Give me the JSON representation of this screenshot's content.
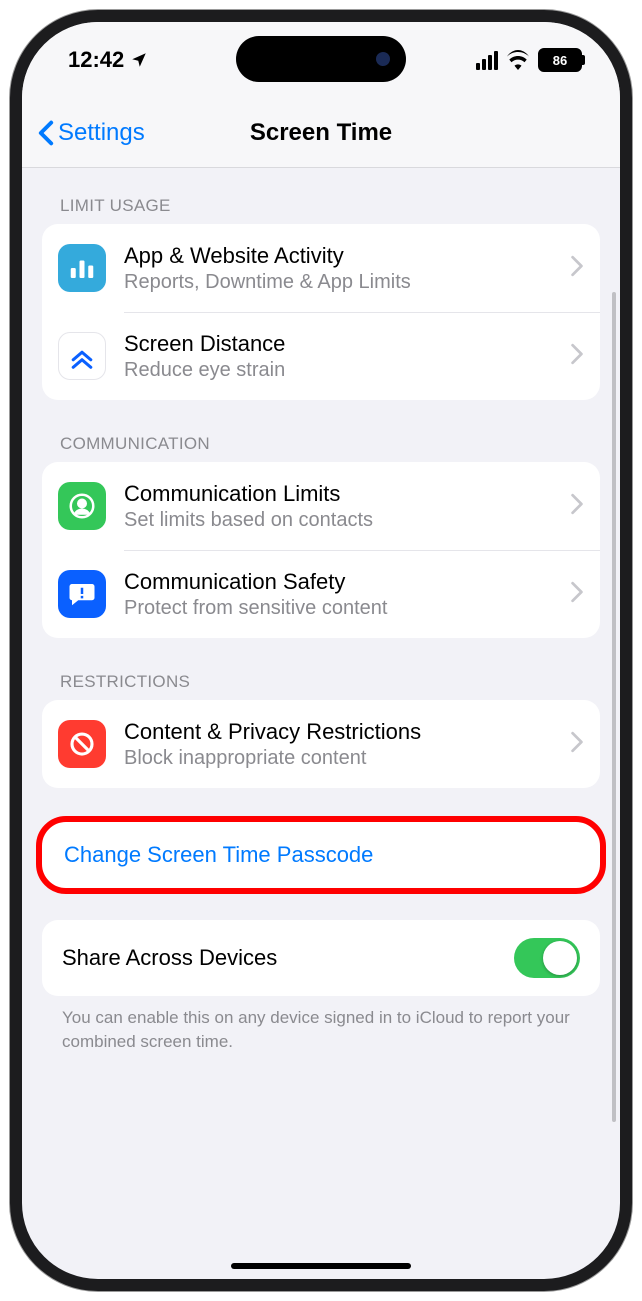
{
  "status": {
    "time": "12:42",
    "battery": "86"
  },
  "nav": {
    "back_label": "Settings",
    "title": "Screen Time"
  },
  "sections": {
    "limit_usage": {
      "header": "LIMIT USAGE",
      "items": [
        {
          "title": "App & Website Activity",
          "subtitle": "Reports, Downtime & App Limits"
        },
        {
          "title": "Screen Distance",
          "subtitle": "Reduce eye strain"
        }
      ]
    },
    "communication": {
      "header": "COMMUNICATION",
      "items": [
        {
          "title": "Communication Limits",
          "subtitle": "Set limits based on contacts"
        },
        {
          "title": "Communication Safety",
          "subtitle": "Protect from sensitive content"
        }
      ]
    },
    "restrictions": {
      "header": "RESTRICTIONS",
      "items": [
        {
          "title": "Content & Privacy Restrictions",
          "subtitle": "Block inappropriate content"
        }
      ]
    }
  },
  "change_passcode": {
    "label": "Change Screen Time Passcode"
  },
  "share": {
    "label": "Share Across Devices",
    "footer": "You can enable this on any device signed in to iCloud to report your combined screen time."
  },
  "colors": {
    "blue": "#007aff",
    "green_toggle": "#34c759",
    "icon_activity": "#34aadc",
    "icon_limits": "#34c759",
    "icon_safety": "#0a60ff",
    "icon_restrict": "#ff3b30"
  }
}
